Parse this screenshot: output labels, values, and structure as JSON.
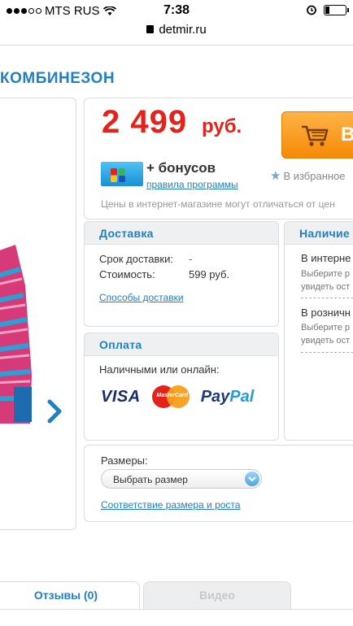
{
  "status_bar": {
    "carrier": "MTS RUS",
    "time": "7:38"
  },
  "browser": {
    "url": "detmir.ru"
  },
  "product": {
    "title": "КОМБИНЕЗОН",
    "price": "2 499",
    "currency": "руб.",
    "buy_label": "В"
  },
  "bonus": {
    "label": "+ бонусов",
    "link": "правила программы"
  },
  "favorite": {
    "label": "В избранное"
  },
  "price_note": "Цены в интернет-магазине могут отличаться от цен",
  "delivery": {
    "heading": "Доставка",
    "term_label": "Срок доставки:",
    "term_value": "-",
    "cost_label": "Стоимость:",
    "cost_value": "599 руб.",
    "methods_link": "Способы доставки"
  },
  "availability": {
    "heading": "Наличие",
    "online_label": "В интерне",
    "online_note_1": "Выберите р",
    "online_note_2": "увидеть ост",
    "retail_label": "В розничн",
    "retail_note_1": "Выберите р",
    "retail_note_2": "увидеть ост"
  },
  "payment": {
    "heading": "Оплата",
    "methods_label": "Наличными или онлайн:",
    "visa": "VISA",
    "mastercard": "MasterCard",
    "paypal_1": "Pay",
    "paypal_2": "Pal"
  },
  "sizes": {
    "label": "Размеры:",
    "select_value": "Выбрать размер",
    "chart_link": "Соответствие размера и роста"
  },
  "tabs": [
    {
      "label": "Отзывы (0)"
    },
    {
      "label": "Видео"
    }
  ],
  "colors": {
    "accent_blue": "#1f80c6",
    "price_red": "#e3231b",
    "buy_orange": "#f58a07"
  }
}
